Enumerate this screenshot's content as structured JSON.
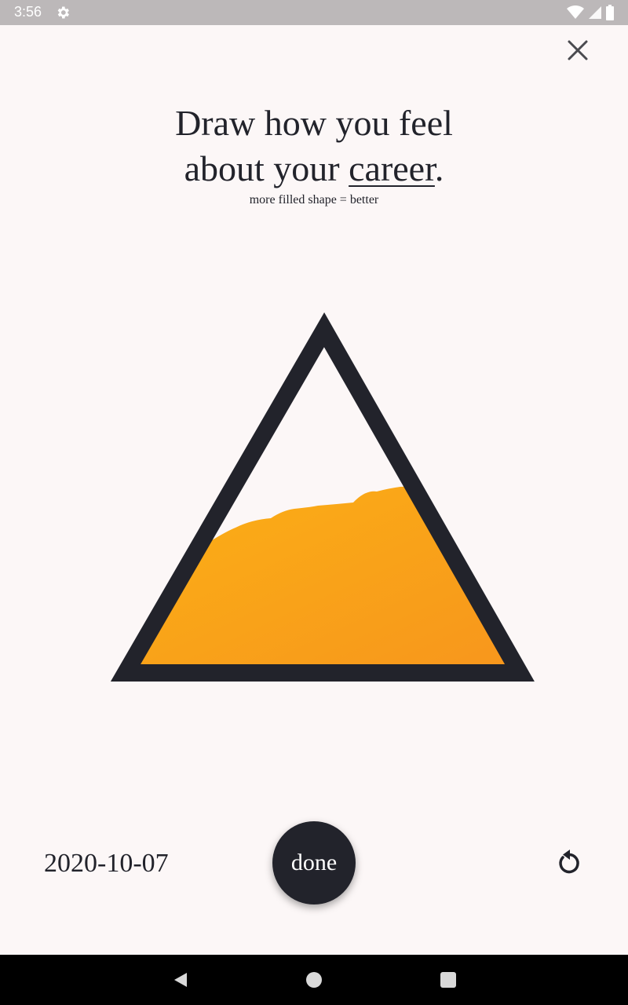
{
  "status_bar": {
    "time": "3:56",
    "icons": [
      "settings-icon",
      "wifi-icon",
      "signal-icon",
      "battery-icon"
    ]
  },
  "header": {
    "close_icon": "close-icon"
  },
  "prompt": {
    "line1": "Draw how you feel",
    "line2_prefix": "about your ",
    "topic": "career",
    "line2_suffix": ".",
    "hint": "more filled shape = better"
  },
  "canvas": {
    "shape": "triangle",
    "fill_level": 0.55,
    "fill_colors": [
      "#fbb015",
      "#f7941d"
    ],
    "outline_color": "#22232b"
  },
  "footer": {
    "date": "2020-10-07",
    "done_label": "done",
    "reset_icon": "undo-icon"
  },
  "nav_bar": {
    "icons": [
      "back-icon",
      "home-icon",
      "recents-icon"
    ]
  }
}
